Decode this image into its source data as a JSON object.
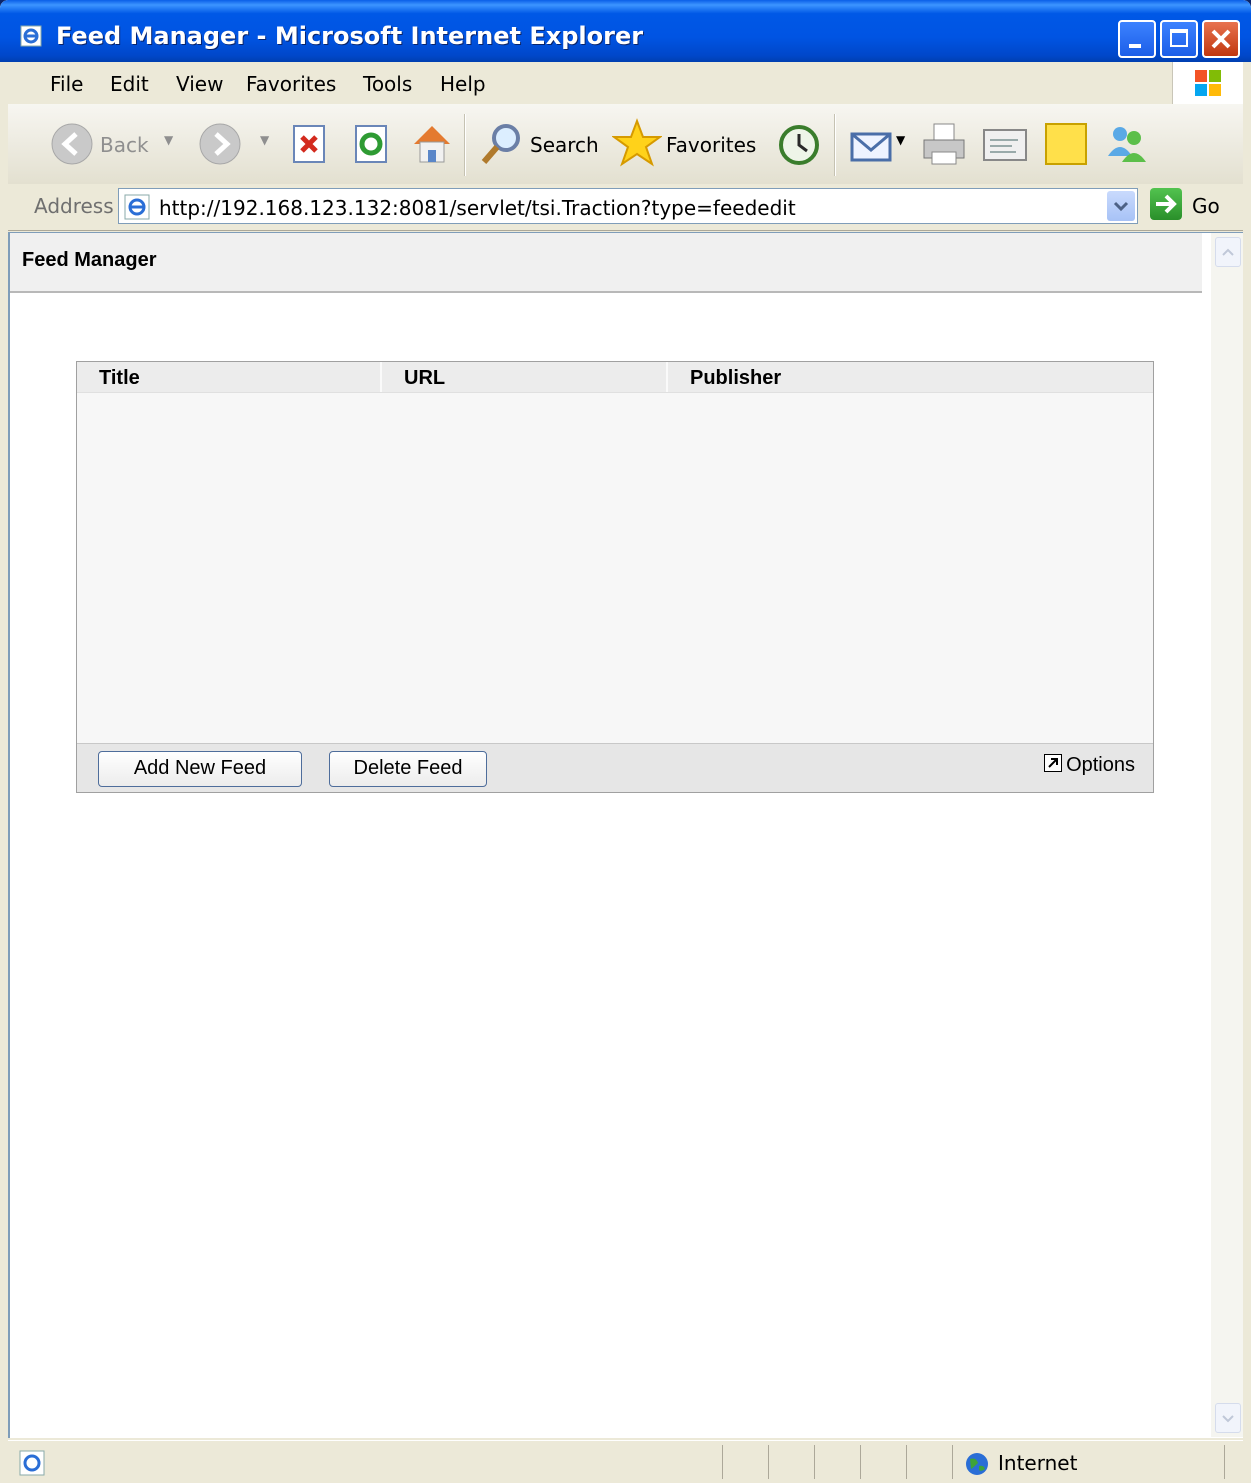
{
  "window": {
    "title": "Feed Manager - Microsoft Internet Explorer"
  },
  "menu": [
    "File",
    "Edit",
    "View",
    "Favorites",
    "Tools",
    "Help"
  ],
  "toolbar": {
    "back": "Back",
    "search": "Search",
    "favorites": "Favorites"
  },
  "address": {
    "label": "Address",
    "url": "http://192.168.123.132:8081/servlet/tsi.Traction?type=feededit",
    "go": "Go"
  },
  "page": {
    "title": "Feed Manager"
  },
  "grid": {
    "columns": [
      "Title",
      "URL",
      "Publisher"
    ],
    "rows": []
  },
  "buttons": {
    "add": "Add New Feed",
    "delete": "Delete Feed",
    "options": "Options"
  },
  "status": {
    "zone": "Internet"
  },
  "colors": {
    "titlebar": "#0054e3",
    "window_frame": "#0a246a",
    "panel": "#ece9d8"
  }
}
